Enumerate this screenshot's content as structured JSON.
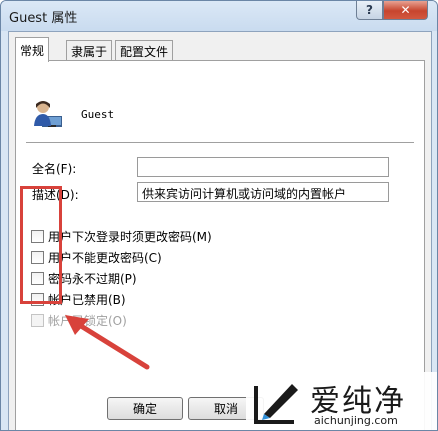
{
  "window": {
    "title": "Guest 属性",
    "help_label": "?",
    "close_label": "✕"
  },
  "tabs": [
    {
      "label": "常规",
      "active": true
    },
    {
      "label": "隶属于",
      "active": false
    },
    {
      "label": "配置文件",
      "active": false
    }
  ],
  "user": {
    "icon": "user-icon",
    "name": "Guest"
  },
  "fields": {
    "fullname_label": "全名(F):",
    "fullname_value": "",
    "description_label": "描述(D):",
    "description_value": "供来宾访问计算机或访问域的内置帐户"
  },
  "checkboxes": [
    {
      "label": "用户下次登录时须更改密码(M)",
      "checked": false,
      "enabled": true
    },
    {
      "label": "用户不能更改密码(C)",
      "checked": false,
      "enabled": true
    },
    {
      "label": "密码永不过期(P)",
      "checked": false,
      "enabled": true
    },
    {
      "label": "帐户已禁用(B)",
      "checked": false,
      "enabled": true
    },
    {
      "label": "帐户已锁定(O)",
      "checked": false,
      "enabled": false
    }
  ],
  "buttons": {
    "ok": "确定",
    "cancel": "取消"
  },
  "annotation": {
    "highlight_color": "#d8423b"
  },
  "watermark": {
    "title": "爱纯净",
    "url": "aichunjing.com"
  }
}
